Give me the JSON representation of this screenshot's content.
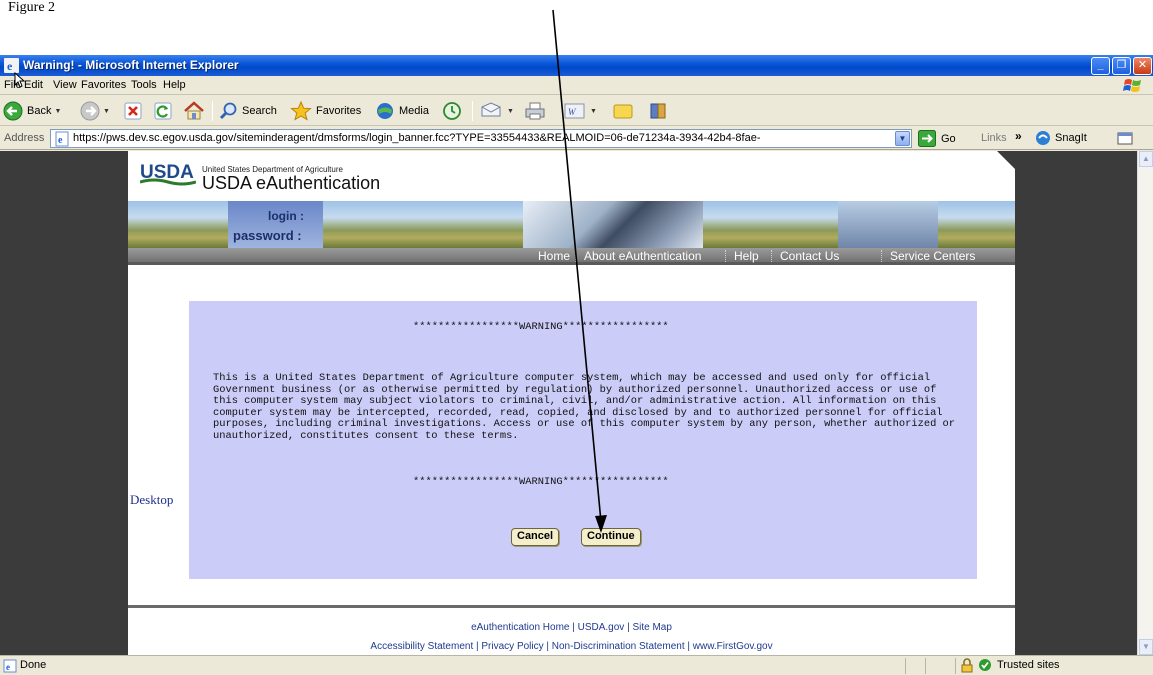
{
  "caption": "Figure 2",
  "window": {
    "title": "Warning! - Microsoft Internet Explorer",
    "buttons": [
      "minimize-icon",
      "restore-icon",
      "close-icon"
    ]
  },
  "menu": [
    "File",
    "Edit",
    "View",
    "Favorites",
    "Tools",
    "Help"
  ],
  "toolbar": {
    "back": "Back",
    "search": "Search",
    "favorites": "Favorites",
    "media": "Media"
  },
  "address": {
    "label": "Address",
    "url": "https://pws.dev.sc.egov.usda.gov/siteminderagent/dmsforms/login_banner.fcc?TYPE=33554433&REALMOID=06-de71234a-3934-42b4-8fae-",
    "go": "Go",
    "links": "Links",
    "chevron": "»",
    "snagit": "SnagIt"
  },
  "header": {
    "logo": "USDA",
    "department": "United States Department of Agriculture",
    "app_name": "USDA eAuthentication",
    "banner_login": "login :",
    "banner_password": "password :"
  },
  "nav": [
    "Home",
    "About eAuthentication",
    "Help",
    "Contact Us",
    "Service Centers"
  ],
  "warning": {
    "banner_line": "*****************WARNING*****************",
    "text": "This is a United States Department of Agriculture computer system, which may be accessed and used only for official Government business (or as otherwise permitted by regulation) by authorized personnel. Unauthorized access or use of this computer system may subject violators to criminal, civil, and/or administrative action. All information on this computer system may be intercepted, recorded, read, copied, and disclosed by and to authorized personnel for official purposes, including criminal investigations. Access or use of this computer system by any person, whether authorized or unauthorized, constitutes consent to these terms.",
    "cancel": "Cancel",
    "continue": "Continue"
  },
  "desktop_link": "Desktop",
  "footer": {
    "row1": "eAuthentication Home | USDA.gov | Site Map",
    "row2": "Accessibility Statement | Privacy Policy | Non-Discrimination Statement | www.FirstGov.gov"
  },
  "status": {
    "text": "Done",
    "zone": "Trusted sites"
  },
  "colors": {
    "titlebar": "#0a58d8",
    "warning_box": "#ccccf8",
    "page_background": "#3b3b3b",
    "nav_bar": "#7a7a7a"
  }
}
